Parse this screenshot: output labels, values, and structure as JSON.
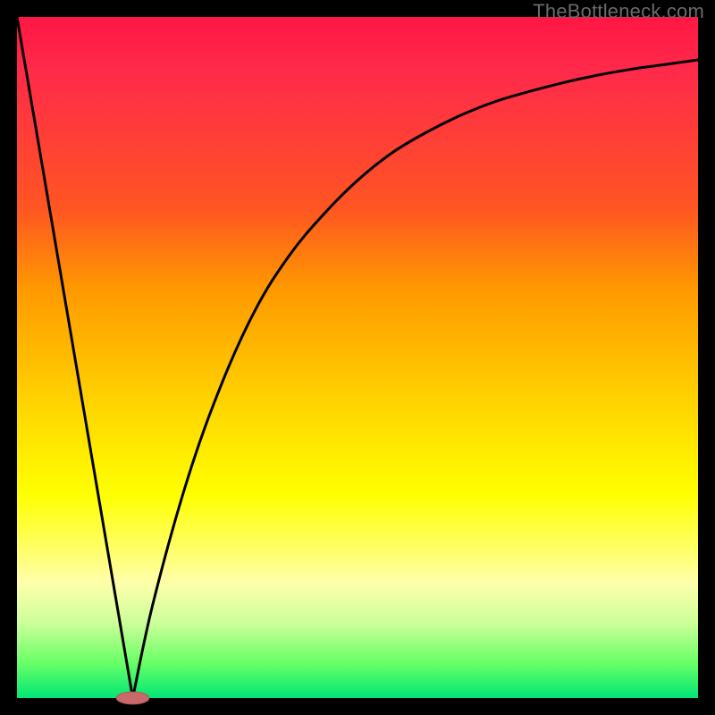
{
  "watermark": {
    "text": "TheBottleneck.com"
  },
  "colors": {
    "frame": "#000000",
    "curve": "#000000",
    "marker_fill": "#c96a6a",
    "marker_stroke": "#b95555"
  },
  "chart_data": {
    "type": "line",
    "title": "",
    "xlabel": "",
    "ylabel": "",
    "xlim": [
      0,
      100
    ],
    "ylim": [
      0,
      100
    ],
    "grid": false,
    "legend": false,
    "annotations": [],
    "series": [
      {
        "name": "left-line",
        "x": [
          0,
          17
        ],
        "values": [
          100,
          0
        ]
      },
      {
        "name": "right-curve",
        "x": [
          17,
          20,
          25,
          30,
          35,
          40,
          45,
          50,
          55,
          60,
          65,
          70,
          75,
          80,
          85,
          90,
          95,
          100
        ],
        "values": [
          0,
          14,
          32,
          46,
          57,
          65,
          71,
          76,
          80,
          83,
          85.5,
          87.5,
          89,
          90.3,
          91.4,
          92.3,
          93,
          93.7
        ]
      }
    ],
    "marker": {
      "x": 17,
      "y": 0,
      "rx_pct": 2.4,
      "ry_pct": 0.9
    }
  }
}
